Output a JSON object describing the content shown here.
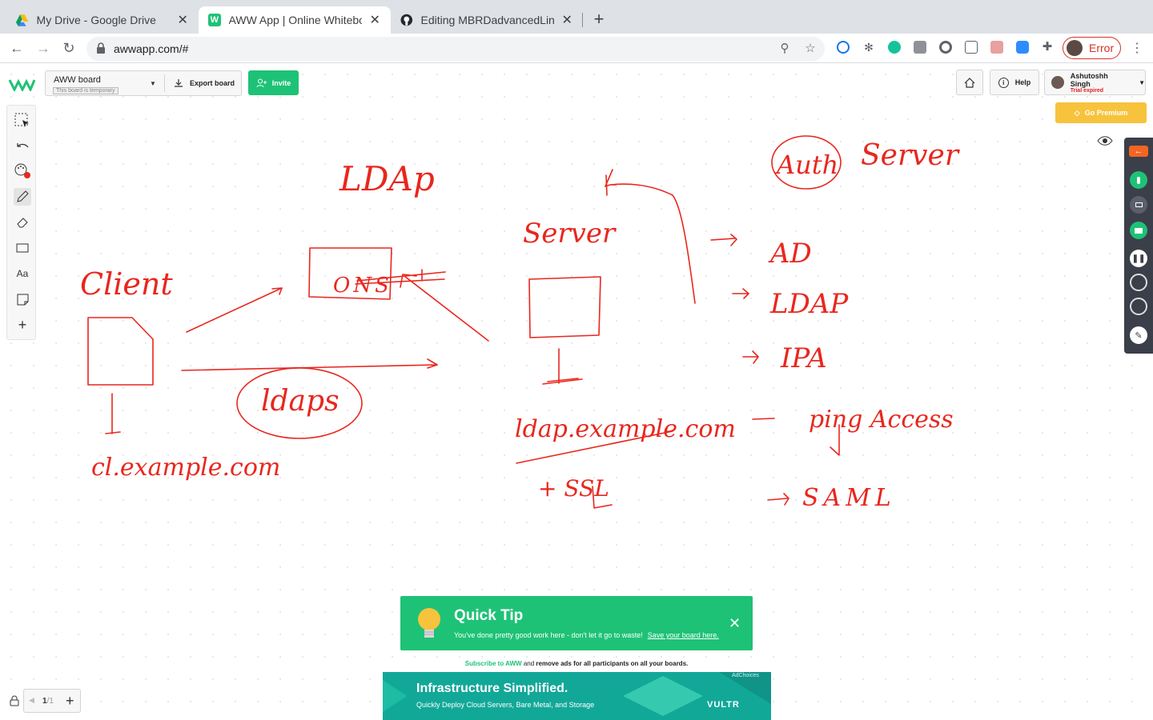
{
  "browser": {
    "tabs": [
      {
        "title": "My Drive - Google Drive",
        "icon": "google-drive-icon"
      },
      {
        "title": "AWW App | Online Whiteboard",
        "icon": "aww-icon"
      },
      {
        "title": "Editing MBRDadvancedLinux/R",
        "icon": "github-icon"
      }
    ],
    "url": "awwapp.com/#",
    "profile_label": "Error"
  },
  "header": {
    "board_name": "AWW board",
    "board_note": "This board is temporary",
    "export_label": "Export board",
    "invite_label": "Invite",
    "help_label": "Help",
    "user_name": "Ashutoshh Singh",
    "user_status": "Trial expired",
    "premium_label": "Go Premium"
  },
  "left_tools": [
    {
      "name": "select-tool",
      "icon": "select-icon"
    },
    {
      "name": "undo-tool",
      "icon": "undo-icon"
    },
    {
      "name": "color-tool",
      "icon": "palette-icon"
    },
    {
      "name": "pen-tool",
      "icon": "pencil-icon"
    },
    {
      "name": "eraser-tool",
      "icon": "eraser-icon"
    },
    {
      "name": "shape-tool",
      "icon": "rectangle-icon"
    },
    {
      "name": "text-tool",
      "label": "Aa"
    },
    {
      "name": "sticky-note-tool",
      "icon": "note-icon"
    },
    {
      "name": "add-tool",
      "icon": "plus-icon"
    }
  ],
  "whiteboard": {
    "ink_color": "#e8271e",
    "words": {
      "ldap": "LDAp",
      "ons": "ONS",
      "client": "Client",
      "ldaps": "ldaps",
      "client_host": "cl.example.com",
      "server": "Server",
      "server_host": "ldap.example.com",
      "ssl": "+ SSL",
      "auth": "Auth",
      "auth_server": "Server",
      "ad": "AD",
      "ldap2": "LDAP",
      "ipa": "IPA",
      "ping": "ping Access",
      "saml": "SAML"
    }
  },
  "tip": {
    "title": "Quick Tip",
    "body": "You've done pretty good work here - don't let it go to waste!",
    "link": "Save your board here."
  },
  "subscribe": {
    "link": "Subscribe to AWW",
    "and": "and",
    "rest": "remove ads for all participants on all your boards."
  },
  "ad": {
    "headline": "Infrastructure Simplified.",
    "body": "Quickly Deploy Cloud Servers, Bare Metal, and Storage",
    "brand": "VULTR",
    "choices": "AdChoices"
  },
  "pager": {
    "page": "1",
    "total": "/1"
  },
  "colors": {
    "green": "#1ec276",
    "premium": "#f7c33c",
    "ink": "#e8271e"
  }
}
